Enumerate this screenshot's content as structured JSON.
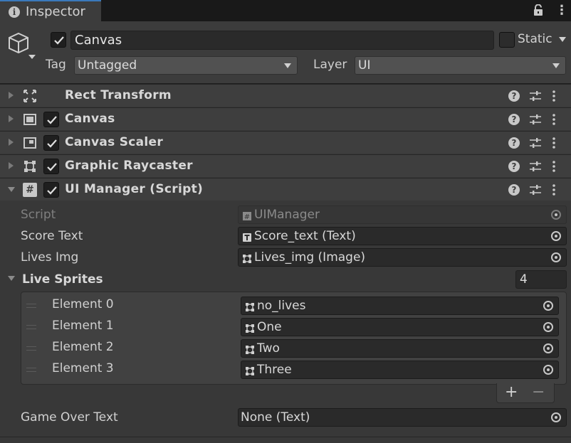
{
  "tab": {
    "title": "Inspector",
    "menu_glyph": "⋮"
  },
  "header": {
    "object_name": "Canvas",
    "static_label": "Static",
    "tag_label": "Tag",
    "tag_value": "Untagged",
    "layer_label": "Layer",
    "layer_value": "UI"
  },
  "components": [
    {
      "title": "Rect Transform",
      "has_checkbox": false,
      "expanded": false,
      "icon": "rect-transform-icon"
    },
    {
      "title": "Canvas",
      "has_checkbox": true,
      "expanded": false,
      "icon": "canvas-icon"
    },
    {
      "title": "Canvas Scaler",
      "has_checkbox": true,
      "expanded": false,
      "icon": "canvas-scaler-icon"
    },
    {
      "title": "Graphic Raycaster",
      "has_checkbox": true,
      "expanded": false,
      "icon": "graphic-raycaster-icon"
    },
    {
      "title": "UI Manager (Script)",
      "has_checkbox": true,
      "expanded": true,
      "icon": "script-icon"
    }
  ],
  "script_fields": {
    "script_label": "Script",
    "script_value": "UIManager",
    "score_text_label": "Score Text",
    "score_text_value": "Score_text (Text)",
    "lives_img_label": "Lives Img",
    "lives_img_value": "Lives_img (Image)",
    "live_sprites_label": "Live Sprites",
    "live_sprites_count": "4",
    "elements": [
      {
        "label": "Element 0",
        "value": "no_lives"
      },
      {
        "label": "Element 1",
        "value": "One"
      },
      {
        "label": "Element 2",
        "value": "Two"
      },
      {
        "label": "Element 3",
        "value": "Three"
      }
    ],
    "add_glyph": "+",
    "remove_glyph": "−",
    "game_over_label": "Game Over Text",
    "game_over_value": "None (Text)"
  },
  "icons": {
    "help_glyph": "?",
    "info_glyph": "i",
    "script_glyph": "#"
  },
  "colors": {
    "accent": "#3a79bb",
    "panel": "#383838",
    "header": "#3e3e3e",
    "field": "#2a2a2a"
  }
}
